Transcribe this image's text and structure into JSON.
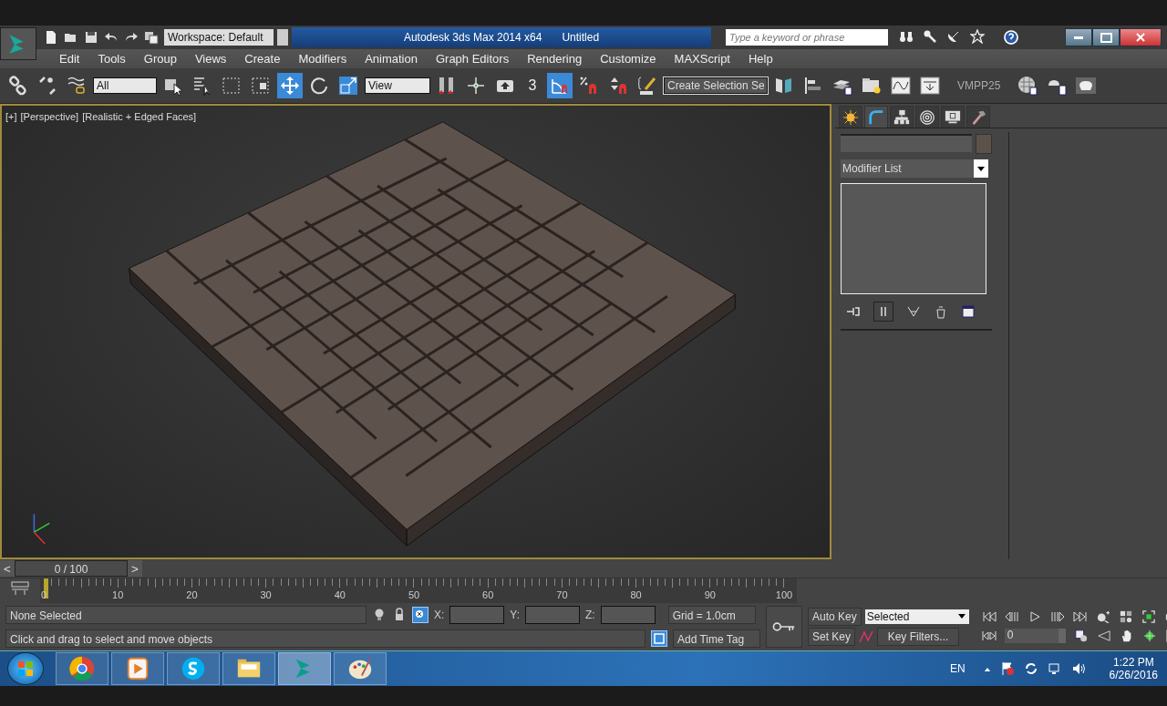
{
  "title_bar": {
    "workspace": "Workspace: Default",
    "app_title": "Autodesk 3ds Max  2014 x64",
    "document": "Untitled",
    "search": {
      "placeholder": "Type a keyword or phrase"
    }
  },
  "menu": [
    "Edit",
    "Tools",
    "Group",
    "Views",
    "Create",
    "Modifiers",
    "Animation",
    "Graph Editors",
    "Rendering",
    "Customize",
    "MAXScript",
    "Help"
  ],
  "main_toolbar": {
    "selection_filter": "All",
    "reference_coordinate": "View",
    "snap_label": "3",
    "named_selection": "Create Selection Se",
    "label": "VMPP25",
    "tools": [
      {
        "kind": "link",
        "selected": false
      },
      {
        "kind": "unlink",
        "selected": false
      },
      {
        "kind": "bind",
        "selected": false
      },
      {
        "kind": "filter"
      },
      {
        "kind": "select",
        "selected": false
      },
      {
        "kind": "select-name",
        "selected": false
      },
      {
        "kind": "region",
        "selected": false
      },
      {
        "kind": "window",
        "selected": false
      },
      {
        "kind": "move",
        "selected": true
      },
      {
        "kind": "rotate",
        "selected": false
      },
      {
        "kind": "scale",
        "selected": false
      },
      {
        "kind": "coord"
      },
      {
        "kind": "pivot",
        "selected": false
      },
      {
        "kind": "manipulate",
        "selected": false
      },
      {
        "kind": "keyboard",
        "selected": false
      },
      {
        "kind": "snap"
      },
      {
        "kind": "angle-snap",
        "selected": true
      },
      {
        "kind": "percent-snap",
        "selected": false
      },
      {
        "kind": "spinner-snap",
        "selected": false
      },
      {
        "kind": "edit-named",
        "selected": false
      },
      {
        "kind": "named"
      },
      {
        "kind": "mirror",
        "selected": false
      },
      {
        "kind": "align",
        "selected": false
      },
      {
        "kind": "layers",
        "selected": false
      },
      {
        "kind": "explorer",
        "selected": false
      },
      {
        "kind": "curve",
        "selected": false
      },
      {
        "kind": "schematic",
        "selected": false
      },
      {
        "kind": "label"
      },
      {
        "kind": "material",
        "selected": false
      },
      {
        "kind": "render-setup",
        "selected": false
      },
      {
        "kind": "render",
        "selected": false
      }
    ]
  },
  "viewport": {
    "labels": [
      "[+]",
      "[Perspective]",
      "[Realistic + Edged Faces]"
    ]
  },
  "command_panel": {
    "tabs": [
      {
        "kind": "create",
        "selected": false
      },
      {
        "kind": "modify",
        "selected": true
      },
      {
        "kind": "hierarchy",
        "selected": false
      },
      {
        "kind": "motion",
        "selected": false
      },
      {
        "kind": "display",
        "selected": false
      },
      {
        "kind": "utilities",
        "selected": false
      }
    ],
    "modifier_list": "Modifier List"
  },
  "time_slider": {
    "prev": "<",
    "reading": "0 / 100",
    "next": ">",
    "level": 0
  },
  "track_bar": {
    "labels": [
      "0",
      "10",
      "20",
      "30",
      "40",
      "50",
      "60",
      "70",
      "80",
      "90",
      "100"
    ]
  },
  "status": {
    "selection": "None Selected",
    "prompt": "Click and drag to select and move objects",
    "x_label": "X:",
    "y_label": "Y:",
    "z_label": "Z:",
    "grid": "Grid = 1.0cm",
    "add_time_tag": "Add Time Tag"
  },
  "animation": {
    "auto_key": "Auto Key",
    "set_key": "Set Key",
    "key_mode": "Selected",
    "key_filters": "Key Filters...",
    "frame": "0"
  },
  "taskbar": {
    "apps": [
      {
        "kind": "browser",
        "active": false
      },
      {
        "kind": "media",
        "active": false
      },
      {
        "kind": "chat",
        "active": false
      },
      {
        "kind": "folder",
        "active": false
      },
      {
        "kind": "max",
        "active": true
      },
      {
        "kind": "paint",
        "active": false
      }
    ],
    "language": "EN",
    "time": "1:22 PM",
    "date": "6/26/2016"
  }
}
